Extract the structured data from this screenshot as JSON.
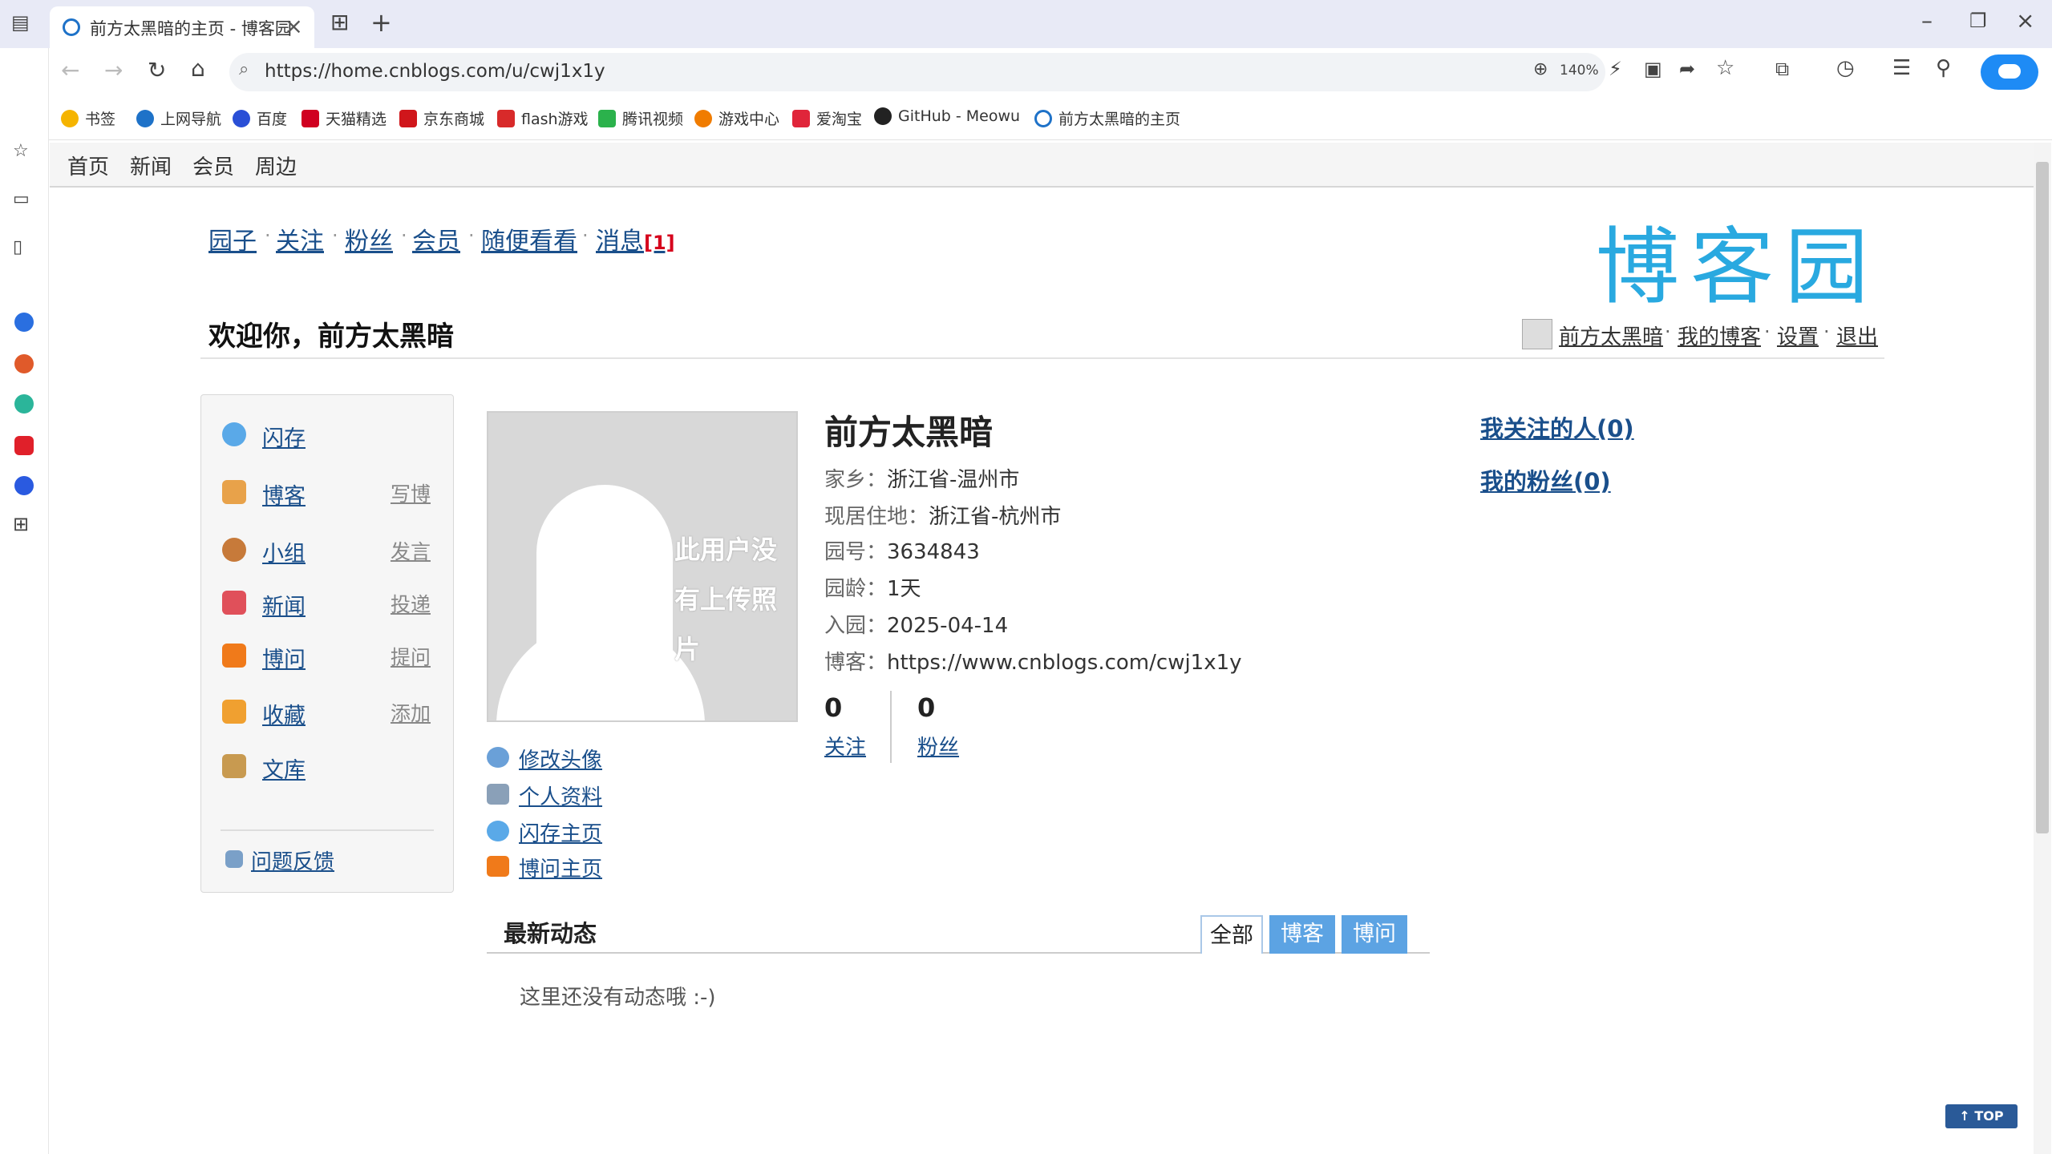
{
  "browser": {
    "tab_title": "前方太黑暗的主页 - 博客园",
    "url": "https://home.cnblogs.com/u/cwj1x1y",
    "zoom": "140%",
    "bookmarks": [
      {
        "label": "书签",
        "color": "#f5b400"
      },
      {
        "label": "上网导航",
        "color": "#1e72c8"
      },
      {
        "label": "百度",
        "color": "#2a4fd6"
      },
      {
        "label": "天猫精选",
        "color": "#d00020"
      },
      {
        "label": "京东商城",
        "color": "#d0161b"
      },
      {
        "label": "flash游戏",
        "color": "#d82a2a"
      },
      {
        "label": "腾讯视频",
        "color": "#2bb24c"
      },
      {
        "label": "游戏中心",
        "color": "#f07c00"
      },
      {
        "label": "爱淘宝",
        "color": "#e0253a"
      },
      {
        "label": "GitHub - Meowu",
        "color": "#222222"
      },
      {
        "label": "前方太黑暗的主页",
        "color": "#1e72c8"
      }
    ]
  },
  "site_nav": [
    "首页",
    "新闻",
    "会员",
    "周边"
  ],
  "top_nav": {
    "links": [
      "园子",
      "关注",
      "粉丝",
      "会员",
      "随便看看",
      "消息"
    ],
    "message_count": "[1]"
  },
  "logo_text": "博客园",
  "welcome": "欢迎你，前方太黑暗",
  "user_links": [
    "前方太黑暗",
    "我的博客",
    "设置",
    "退出"
  ],
  "left_menu": [
    {
      "label": "闪存",
      "action": "",
      "icon_color": "#5aa9e8"
    },
    {
      "label": "博客",
      "action": "写博",
      "icon_color": "#e8a24a"
    },
    {
      "label": "小组",
      "action": "发言",
      "icon_color": "#c77a3a"
    },
    {
      "label": "新闻",
      "action": "投递",
      "icon_color": "#e0505a"
    },
    {
      "label": "博问",
      "action": "提问",
      "icon_color": "#f07a1a"
    },
    {
      "label": "收藏",
      "action": "添加",
      "icon_color": "#f0a030"
    },
    {
      "label": "文库",
      "action": "",
      "icon_color": "#c89a50"
    }
  ],
  "feedback": "问题反馈",
  "avatar_placeholder": "此用户没有上传照片",
  "avatar_actions": [
    {
      "label": "修改头像",
      "icon_color": "#6aa0d8"
    },
    {
      "label": "个人资料",
      "icon_color": "#8aa0b8"
    },
    {
      "label": "闪存主页",
      "icon_color": "#5aa9e8"
    },
    {
      "label": "博问主页",
      "icon_color": "#f07a1a"
    }
  ],
  "profile": {
    "name": "前方太黑暗",
    "hometown_label": "家乡：",
    "hometown": "浙江省-温州市",
    "residence_label": "现居住地：",
    "residence": "浙江省-杭州市",
    "id_label": "园号：",
    "id": "3634843",
    "age_label": "园龄：",
    "age": "1天",
    "joined_label": "入园：",
    "joined": "2025-04-14",
    "blog_label": "博客：",
    "blog_url": "https://www.cnblogs.com/cwj1x1y",
    "following_count": "0",
    "following_label": "关注",
    "followers_count": "0",
    "followers_label": "粉丝"
  },
  "right_links": [
    "我关注的人(0)",
    "我的粉丝(0)"
  ],
  "feed": {
    "title": "最新动态",
    "tabs": [
      "全部",
      "博客",
      "博问"
    ],
    "empty": "这里还没有动态哦 :-)"
  },
  "top_button": "↑ TOP"
}
